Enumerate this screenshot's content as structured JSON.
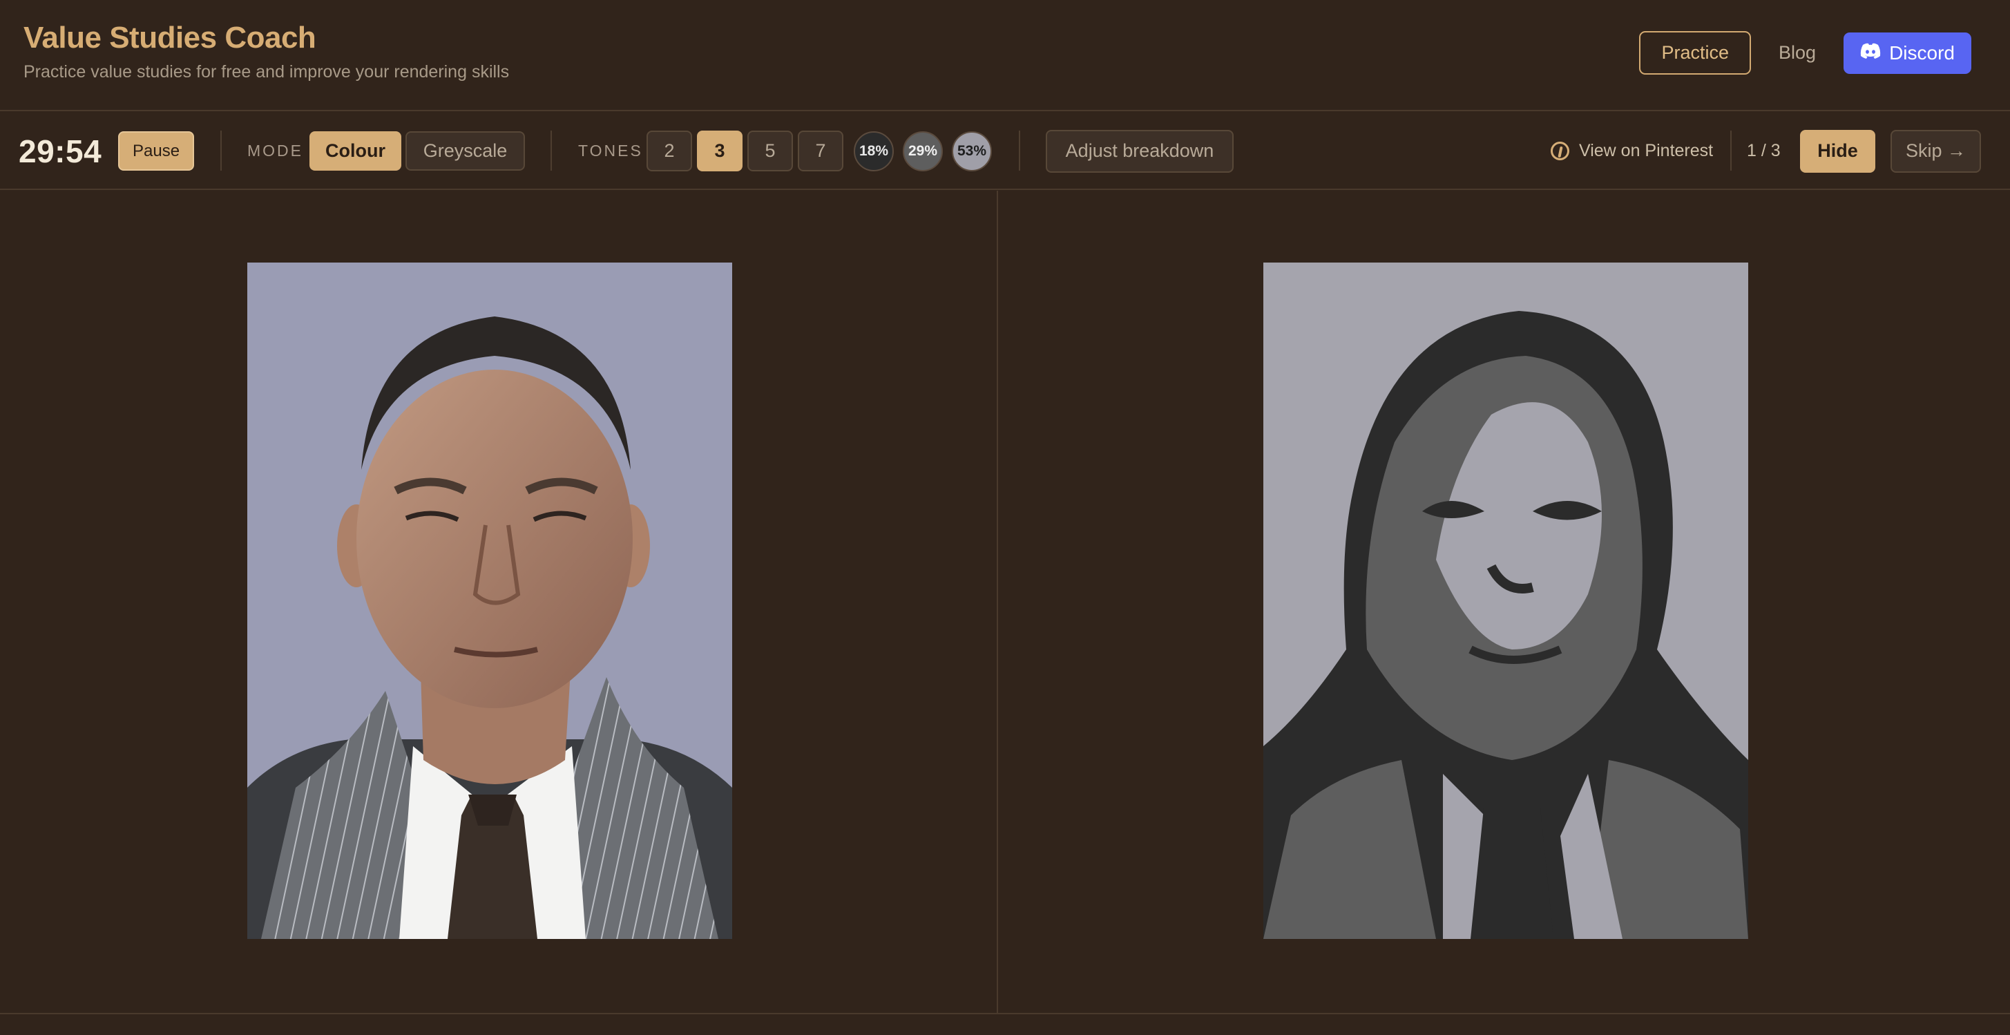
{
  "header": {
    "title": "Value Studies Coach",
    "subtitle": "Practice value studies for free and improve your rendering skills",
    "nav": {
      "practice": "Practice",
      "blog": "Blog",
      "discord": "Discord"
    }
  },
  "toolbar": {
    "timer": "29:54",
    "pause_label": "Pause",
    "mode": {
      "label": "MODE",
      "options": [
        "Colour",
        "Greyscale"
      ],
      "selected": "Colour"
    },
    "tones": {
      "label": "TONES",
      "options": [
        "2",
        "3",
        "5",
        "7"
      ],
      "selected": "3",
      "swatches": [
        {
          "label": "18%",
          "color": "#2b2b2b"
        },
        {
          "label": "29%",
          "color": "#5e5e5e"
        },
        {
          "label": "53%",
          "color": "#a09fa8"
        }
      ]
    },
    "adjust_label": "Adjust breakdown",
    "pinterest_label": "View on Pinterest",
    "counter": "1 / 3",
    "hide_label": "Hide",
    "skip_label": "Skip →"
  },
  "colors": {
    "background": "#31241b",
    "accent": "#d6ae77",
    "discord": "#5865f2"
  }
}
